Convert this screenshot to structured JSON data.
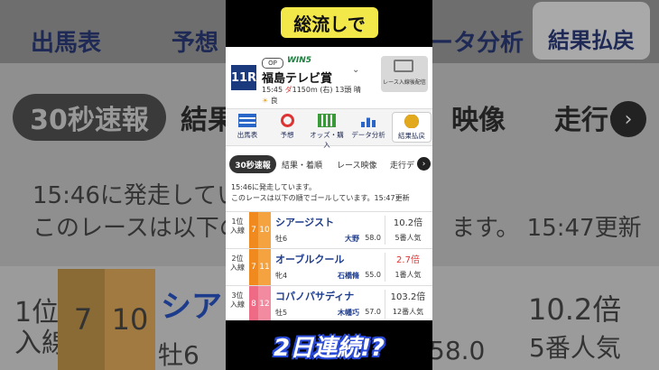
{
  "background": {
    "nav": [
      "出馬表",
      "予想",
      "ータ分析"
    ],
    "nav_active": "結果払戻",
    "tabs": [
      "30秒速報",
      "結果",
      "映像",
      "走行デ"
    ],
    "line1": "15:46に発走してい",
    "line2": "このレースは以下の",
    "line2b": "ます。 15:47更新",
    "rank": "1位\n入線",
    "waku": "7",
    "umaban": "10",
    "name": "シア",
    "sexage": "牡6",
    "weight": "58.0",
    "odds": "10.2倍",
    "pop": "5番人気"
  },
  "banner": {
    "title": "総流しで"
  },
  "race": {
    "number": "11R",
    "grade": "OP",
    "win5": "WIN5",
    "name": "福島テレビ賞",
    "time": "15:45",
    "track_type": "ダ",
    "distance": "1150m",
    "direction": "(右)",
    "entries": "13頭",
    "weather": "晴",
    "condition": "良",
    "video_label": "レース入線後配信"
  },
  "nav": [
    {
      "label": "出馬表",
      "icon": "race-card-icon"
    },
    {
      "label": "予想",
      "icon": "target-icon"
    },
    {
      "label": "オッズ・購入",
      "icon": "odds-icon"
    },
    {
      "label": "データ分析",
      "icon": "data-analysis-icon"
    },
    {
      "label": "結果払戻",
      "icon": "coins-icon"
    }
  ],
  "tabs": [
    "30秒速報",
    "結果・着順",
    "レース映像",
    "走行デ"
  ],
  "notice": {
    "line1": "15:46に発走しています。",
    "line2": "このレースは以下の順でゴールしています。15:47更新"
  },
  "results": [
    {
      "rank": "1位",
      "sub": "入線",
      "waku": "7",
      "umaban": "10",
      "horse": "シアージスト",
      "sexage": "牡6",
      "jockey": "大野",
      "weight": "58.0",
      "odds": "10.2倍",
      "pop": "5番人気",
      "waku_color": "#f08a1e"
    },
    {
      "rank": "2位",
      "sub": "入線",
      "waku": "7",
      "umaban": "11",
      "horse": "オーブルクール",
      "sexage": "牝4",
      "jockey": "石橋脩",
      "weight": "55.0",
      "odds": "2.7倍",
      "pop": "1番人気",
      "waku_color": "#f08a1e"
    },
    {
      "rank": "3位",
      "sub": "入線",
      "waku": "8",
      "umaban": "12",
      "horse": "コパノパサディナ",
      "sexage": "牡5",
      "jockey": "木幡巧",
      "weight": "57.0",
      "odds": "103.2倍",
      "pop": "12番人気",
      "waku_color": "#ef6a85"
    }
  ],
  "footer": {
    "caption": "2日連続!?"
  }
}
